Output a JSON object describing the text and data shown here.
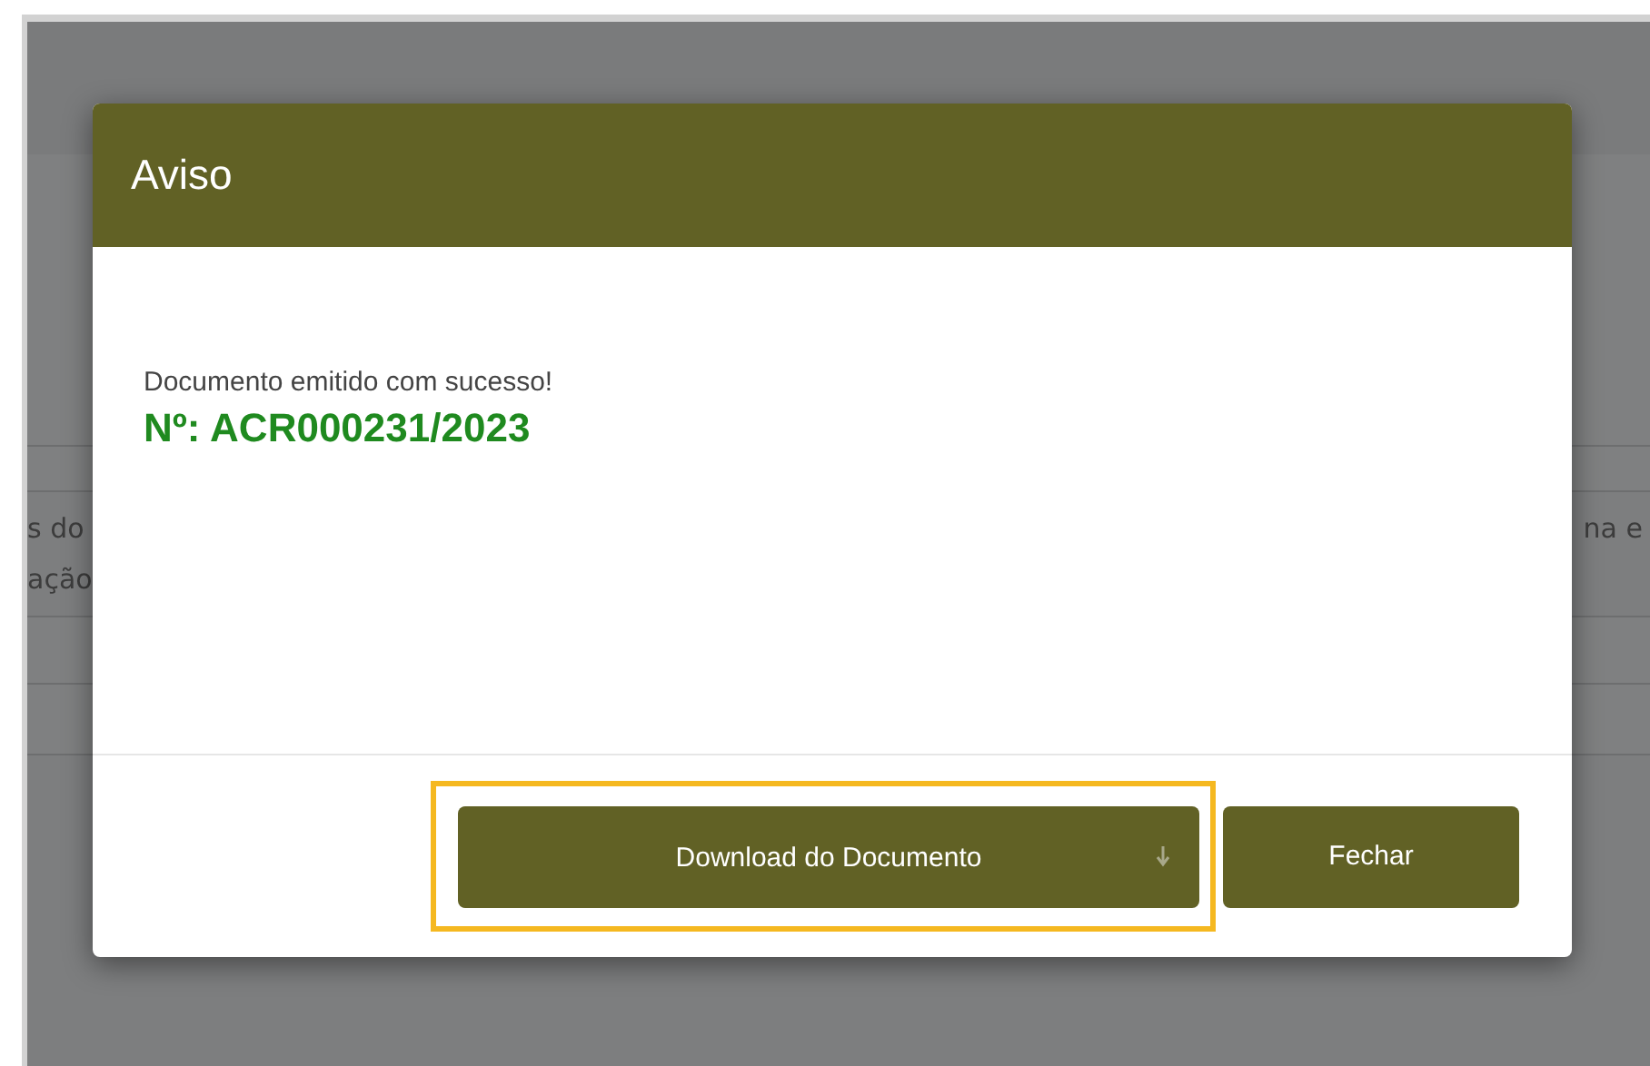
{
  "background": {
    "lines": [
      {
        "left": "s do",
        "right": "na e"
      },
      {
        "left": "ação"
      }
    ]
  },
  "dialog": {
    "title": "Aviso",
    "message": "Documento emitido com sucesso!",
    "number": "Nº: ACR000231/2023",
    "buttons": [
      {
        "label": "Download do Documento",
        "kind": "download",
        "highlighted": true
      },
      {
        "label": "Fechar",
        "kind": "plain",
        "highlighted": false
      }
    ]
  }
}
